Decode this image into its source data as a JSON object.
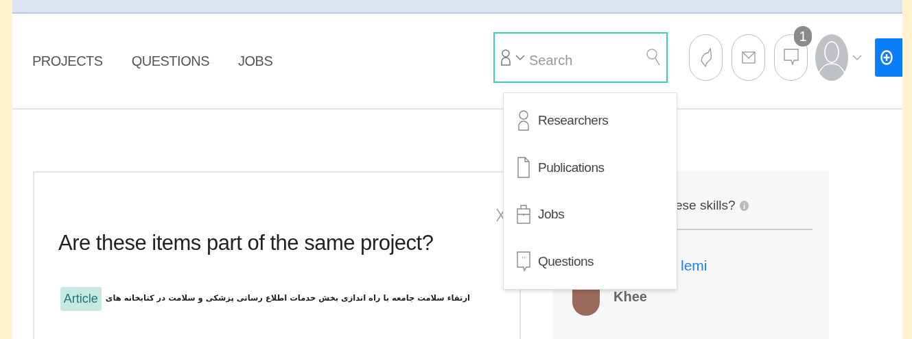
{
  "nav": [
    {
      "label": "PROJECTS"
    },
    {
      "label": "QUESTIONS"
    },
    {
      "label": "JOBS"
    }
  ],
  "search": {
    "placeholder": "Search"
  },
  "search_menu": [
    {
      "kind": "person",
      "label": "Researchers"
    },
    {
      "kind": "document",
      "label": "Publications"
    },
    {
      "kind": "briefcase",
      "label": "Jobs"
    },
    {
      "kind": "chat",
      "label": "Questions"
    }
  ],
  "header_badge": "1",
  "prompt_card": {
    "title": "Are these items part of the same project?",
    "item_text": "ارتقاء سلامت جامعه با راه اندازی بخش خدمات اطلاع رسانی پزشکی و سلامت در کتابخانه های",
    "item_tag": "Article"
  },
  "skills_card": {
    "title": "ese skills?",
    "link": "lemi",
    "person_name": "Khee"
  }
}
